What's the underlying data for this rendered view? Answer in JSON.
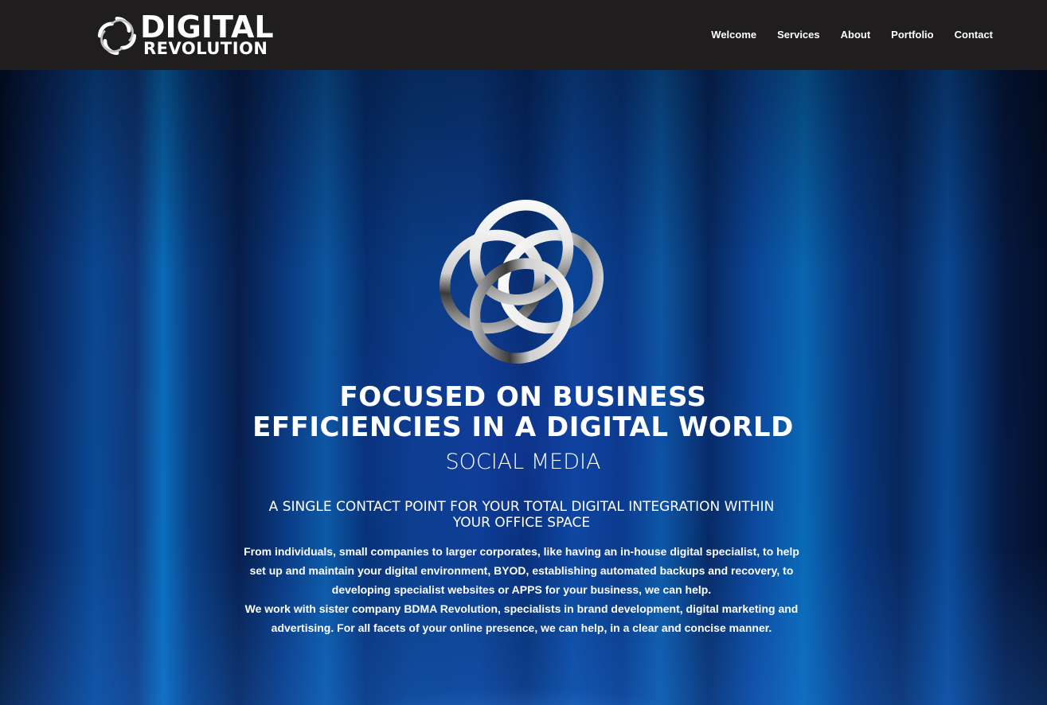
{
  "header": {
    "logo": {
      "line1": "DIGITAL",
      "line2": "REVOLUTION",
      "icon": "swirl-logo-icon"
    },
    "nav": [
      {
        "label": "Welcome"
      },
      {
        "label": "Services"
      },
      {
        "label": "About"
      },
      {
        "label": "Portfolio"
      },
      {
        "label": "Contact"
      }
    ]
  },
  "hero": {
    "emblem_icon": "interlocking-rings-logo-icon",
    "headline_line1": "FOCUSED ON BUSINESS",
    "headline_line2": "EFFICIENCIES IN A DIGITAL WORLD",
    "rotating_service": "SOCIAL MEDIA",
    "tagline_line1": "A SINGLE CONTACT POINT FOR YOUR TOTAL DIGITAL INTEGRATION WITHIN",
    "tagline_line2": "YOUR OFFICE SPACE",
    "paragraph1": "From individuals, small companies to larger corporates, like having an in-house digital specialist, to help set up and maintain your digital environment, BYOD, establishing automated backups and recovery, to developing specialist websites or APPS for your business, we can help.",
    "paragraph2": "We work with sister company BDMA Revolution, specialists in brand development, digital marketing and advertising. For all facets of your online presence, we can help, in a clear and concise manner."
  },
  "colors": {
    "header_bg": "#1f1d1d",
    "hero_blue": "#0b4a98",
    "text": "#ffffff"
  }
}
